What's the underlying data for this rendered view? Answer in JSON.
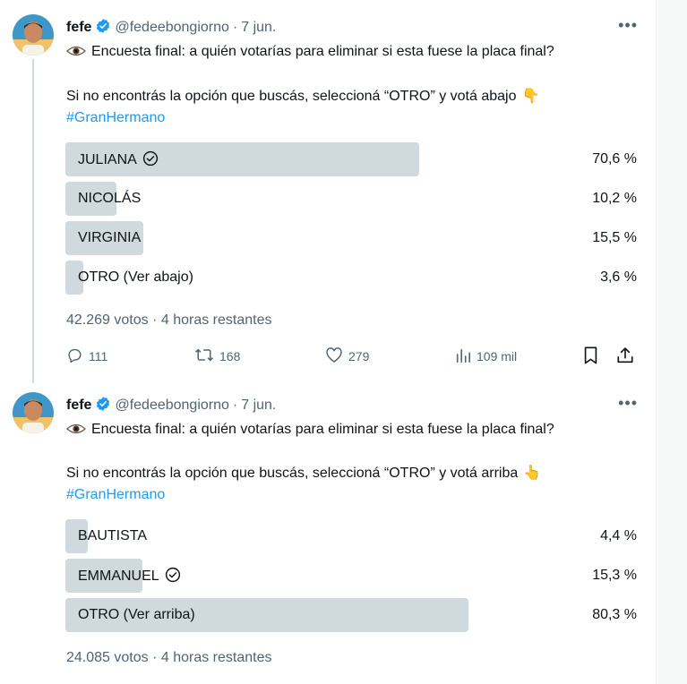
{
  "tweets": [
    {
      "author": {
        "name": "fefe",
        "handle": "@fedeebongiorno",
        "separator": "·",
        "date": "7 jun."
      },
      "text_line1": "Encuesta final: a quién votarías para eliminar si esta fuese la placa final?",
      "text_line2": "Si no encontrás la opción que buscás, seleccioná “OTRO” y votá abajo",
      "hand_emoji": "👇",
      "hashtag": "#GranHermano",
      "poll": {
        "options": [
          {
            "label": "JULIANA",
            "percent_label": "70,6 %",
            "percent": 70.6,
            "selected": true
          },
          {
            "label": "NICOLÁS",
            "percent_label": "10,2 %",
            "percent": 10.2,
            "selected": false
          },
          {
            "label": "VIRGINIA",
            "percent_label": "15,5 %",
            "percent": 15.5,
            "selected": false
          },
          {
            "label": "OTRO (Ver abajo)",
            "percent_label": "3,6 %",
            "percent": 3.6,
            "selected": false
          }
        ],
        "meta": "42.269 votos · 4 horas restantes"
      },
      "actions": {
        "replies": "111",
        "retweets": "168",
        "likes": "279",
        "views": "109 mil"
      }
    },
    {
      "author": {
        "name": "fefe",
        "handle": "@fedeebongiorno",
        "separator": "·",
        "date": "7 jun."
      },
      "text_line1": "Encuesta final: a quién votarías para eliminar si esta fuese la placa final?",
      "text_line2": "Si no encontrás la opción que buscás, seleccioná “OTRO” y votá arriba",
      "hand_emoji": "👆",
      "hashtag": "#GranHermano",
      "poll": {
        "options": [
          {
            "label": "BAUTISTA",
            "percent_label": "4,4 %",
            "percent": 4.4,
            "selected": false
          },
          {
            "label": "EMMANUEL",
            "percent_label": "15,3 %",
            "percent": 15.3,
            "selected": true
          },
          {
            "label": "OTRO (Ver arriba)",
            "percent_label": "80,3 %",
            "percent": 80.3,
            "selected": false
          }
        ],
        "meta": "24.085 votos · 4 horas restantes"
      }
    }
  ],
  "colors": {
    "accent": "#1d9bf0",
    "poll_bar": "#cfd9de",
    "secondary_text": "#536471"
  },
  "icons": [
    "verified-badge-icon",
    "eye-icon",
    "check-circle-icon",
    "reply-icon",
    "retweet-icon",
    "like-icon",
    "views-icon",
    "bookmark-icon",
    "share-icon",
    "more-icon"
  ]
}
